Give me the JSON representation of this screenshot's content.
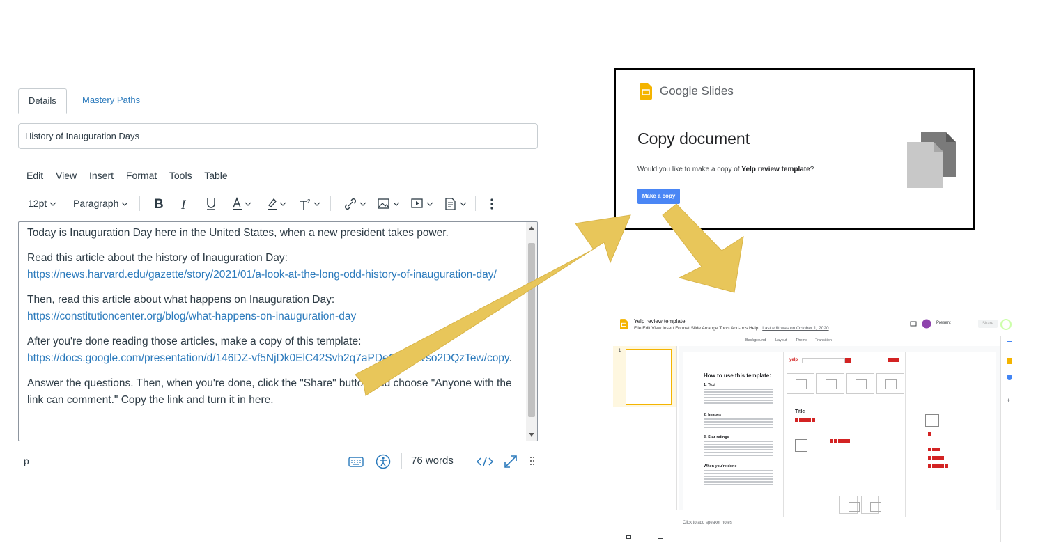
{
  "tabs": [
    {
      "label": "Details"
    },
    {
      "label": "Mastery Paths"
    }
  ],
  "title_field": {
    "value": "History of Inauguration Days"
  },
  "menubar": [
    "Edit",
    "View",
    "Insert",
    "Format",
    "Tools",
    "Table"
  ],
  "toolbar": {
    "font_size": "12pt",
    "block_format": "Paragraph"
  },
  "editor": {
    "p1": "Today is Inauguration Day here in the United States, when a new president takes power.",
    "p2_text": "Read this article about the history of Inauguration Day:",
    "p2_link": "https://news.harvard.edu/gazette/story/2021/01/a-look-at-the-long-odd-history-of-inauguration-day/",
    "p3_text": "Then, read this article about what happens on Inauguration Day:",
    "p3_link": "https://constitutioncenter.org/blog/what-happens-on-inauguration-day",
    "p4_text": "After you're done reading those articles, make a copy of this template:",
    "p4_link": "https://docs.google.com/presentation/d/146DZ-vf5NjDk0ElC42Svh2q7aPDeCofSNvso2DQzTew/copy",
    "p4_after": ".",
    "p5": "Answer the questions. Then, when you're done, click the \"Share\" button and choose \"Anyone with the link can comment.\" Copy the link and turn it in here."
  },
  "statusbar": {
    "element_path": "p",
    "word_count": "76 words"
  },
  "copy_dialog": {
    "app_name": "Google Slides",
    "heading": "Copy document",
    "question_prefix": "Would you like to make a copy of ",
    "doc_name": "Yelp review template",
    "question_suffix": "?",
    "button": "Make a copy"
  },
  "slides_preview": {
    "title": "Yelp review template",
    "menu": [
      "File",
      "Edit",
      "View",
      "Insert",
      "Format",
      "Slide",
      "Arrange",
      "Tools",
      "Add-ons",
      "Help"
    ],
    "last_edit": "Last edit was on October 1, 2020",
    "present": "Present",
    "share": "Share",
    "toolbar": [
      "Background",
      "Layout",
      "Theme",
      "Transition"
    ],
    "slide_number": "1",
    "how_title": "How to use this template:",
    "how_sections": [
      "1. Text",
      "2. Images",
      "3. Star ratings",
      "When you're done"
    ],
    "yelp_brand": "yelp",
    "card_title": "Title",
    "notes": "Click to add speaker notes"
  },
  "colors": {
    "link": "#2b7abc",
    "arrow": "#e8c65a",
    "slides_yellow": "#f4b400",
    "button_blue": "#4a86f5",
    "yelp_red": "#d32323"
  }
}
